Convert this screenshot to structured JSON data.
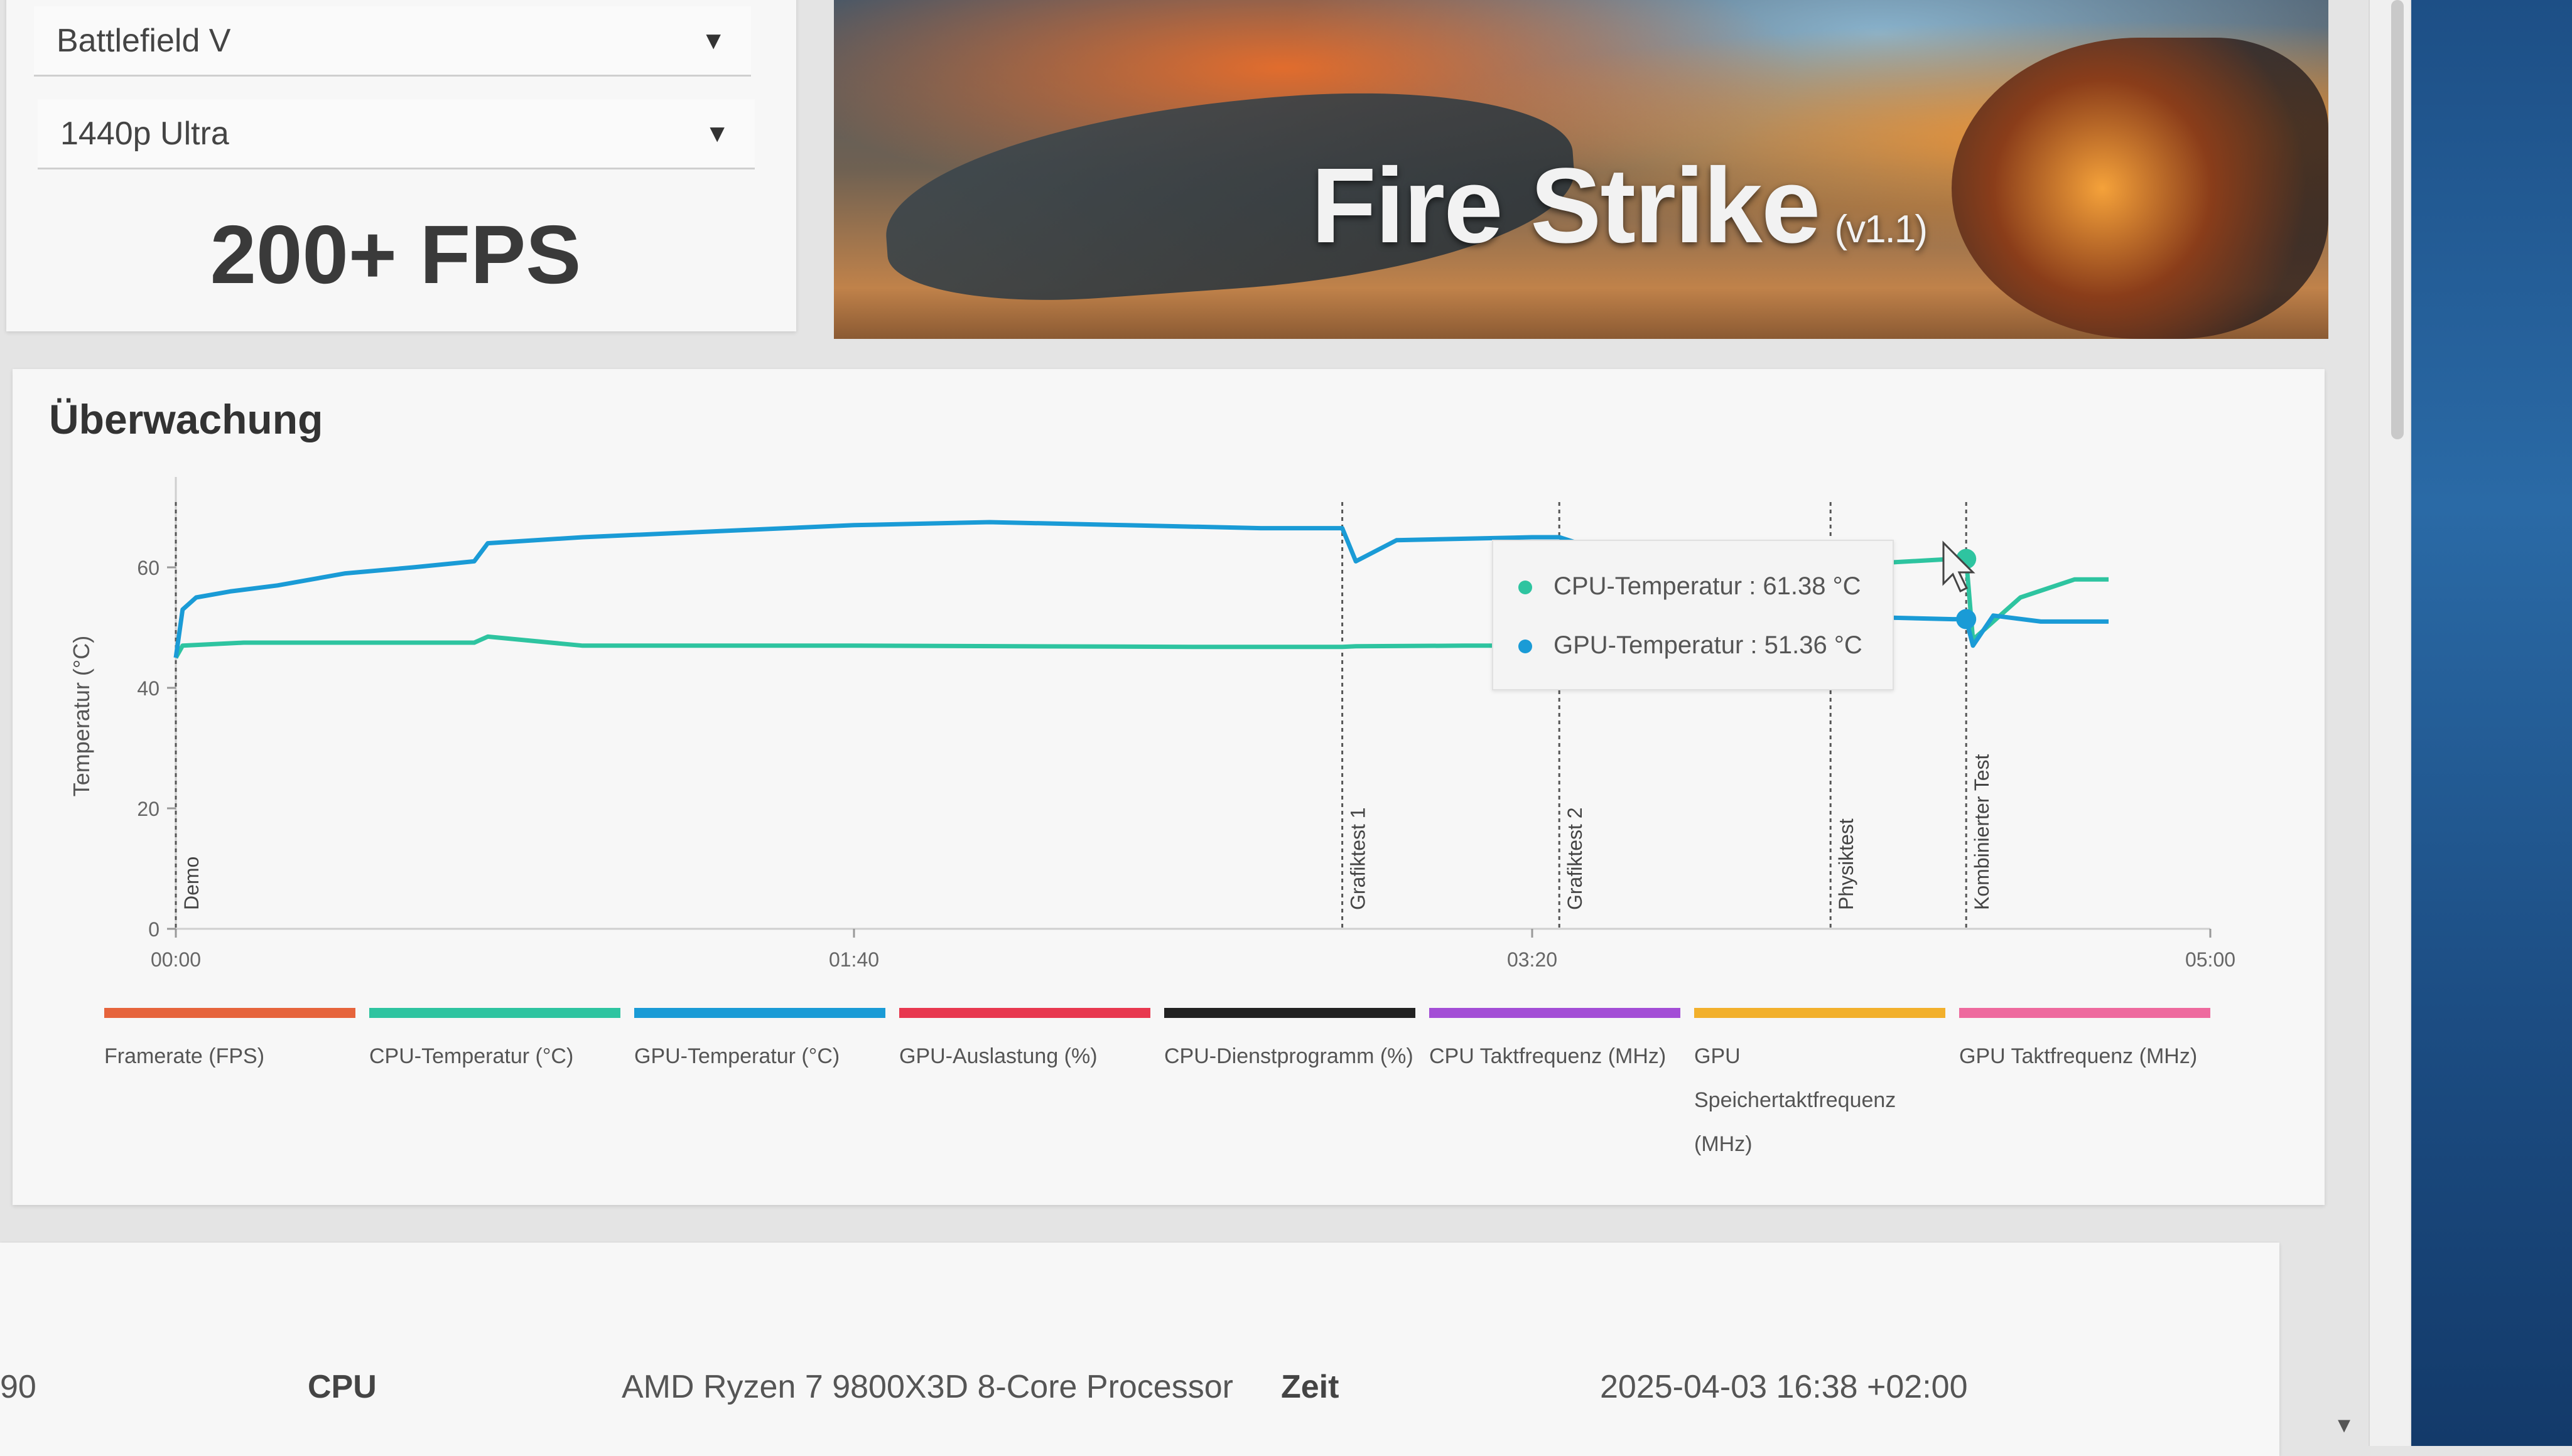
{
  "game_select": {
    "value": "Battlefield V"
  },
  "preset_select": {
    "value": "1440p Ultra"
  },
  "fps_estimate": "200+ FPS",
  "banner": {
    "title": "Fire Strike",
    "version": "(v1.1)"
  },
  "monitoring": {
    "title": "Überwachung"
  },
  "chart_data": {
    "type": "line",
    "xlabel": "",
    "ylabel": "Temperatur (°C)",
    "x_ticks": [
      "00:00",
      "01:40",
      "03:20",
      "05:00"
    ],
    "y_ticks": [
      0,
      20,
      40,
      60
    ],
    "xlim_seconds": [
      0,
      300
    ],
    "ylim": [
      0,
      75
    ],
    "markers": [
      {
        "label": "Demo",
        "t": 0
      },
      {
        "label": "Grafiktest 1",
        "t": 172
      },
      {
        "label": "Grafiktest 2",
        "t": 204
      },
      {
        "label": "Physiktest",
        "t": 244
      },
      {
        "label": "Kombinierter Test",
        "t": 264
      }
    ],
    "series": [
      {
        "name": "CPU-Temperatur (°C)",
        "color": "#2ec4a0",
        "t": [
          0,
          1,
          10,
          30,
          44,
          46,
          60,
          100,
          150,
          170,
          172,
          174,
          190,
          200,
          240,
          262,
          264,
          265,
          267,
          272,
          280,
          285
        ],
        "values": [
          45,
          47,
          47.5,
          47.5,
          47.5,
          48.5,
          47,
          47,
          46.8,
          46.8,
          46.8,
          46.9,
          47,
          47,
          60,
          61.4,
          61.4,
          48,
          50,
          55,
          58,
          58
        ]
      },
      {
        "name": "GPU-Temperatur (°C)",
        "color": "#1a9bd6",
        "t": [
          0,
          1,
          3,
          8,
          15,
          25,
          35,
          44,
          46,
          60,
          80,
          100,
          120,
          140,
          160,
          170,
          172,
          174,
          180,
          200,
          204,
          240,
          262,
          264,
          265,
          268,
          275,
          285
        ],
        "values": [
          45,
          53,
          55,
          56,
          57,
          59,
          60,
          61,
          64,
          65,
          66,
          67,
          67.5,
          67,
          66.5,
          66.5,
          66.5,
          61,
          64.5,
          65,
          65,
          52,
          51.4,
          51.4,
          47,
          52,
          51,
          51
        ]
      }
    ],
    "legend": [
      {
        "label": "Framerate (FPS)",
        "color": "#e6643c"
      },
      {
        "label": "CPU-Temperatur (°C)",
        "color": "#2ec4a0"
      },
      {
        "label": "GPU-Temperatur (°C)",
        "color": "#1a9bd6"
      },
      {
        "label": "GPU-Auslastung (%)",
        "color": "#e8384f"
      },
      {
        "label": "CPU-Dienstprogramm (%)",
        "color": "#222222"
      },
      {
        "label": "CPU Taktfrequenz (MHz)",
        "color": "#a34ed6"
      },
      {
        "label": "GPU Speichertaktfrequenz (MHz)",
        "color": "#f2b02c"
      },
      {
        "label": "GPU Taktfrequenz (MHz)",
        "color": "#ee6a9e"
      }
    ],
    "tooltip": {
      "rows": [
        {
          "label": "CPU-Temperatur : 61.38 °C",
          "color": "#2ec4a0"
        },
        {
          "label": "GPU-Temperatur : 51.36 °C",
          "color": "#1a9bd6"
        }
      ]
    }
  },
  "details": {
    "left_partial": "90",
    "cpu_label": "CPU",
    "cpu_value": "AMD Ryzen 7 9800X3D 8-Core Processor",
    "time_label": "Zeit",
    "time_value": "2025-04-03 16:38 +02:00"
  }
}
